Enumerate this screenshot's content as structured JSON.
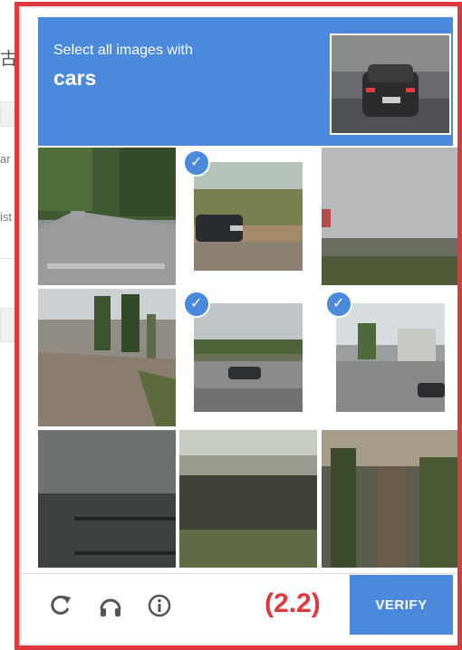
{
  "background": {
    "fragments": [
      "古",
      "ar",
      "ist"
    ]
  },
  "challenge": {
    "instruction": "Select all images with",
    "target": "cars",
    "accent_color": "#4a89dc",
    "tiles": [
      {
        "name": "tile-1",
        "scene": "tree-lined street with parked car",
        "selected": false
      },
      {
        "name": "tile-2",
        "scene": "dark car parked by field",
        "selected": true
      },
      {
        "name": "tile-3",
        "scene": "cloudy sky over trees",
        "selected": false
      },
      {
        "name": "tile-4",
        "scene": "road with trees and poles",
        "selected": false
      },
      {
        "name": "tile-5",
        "scene": "car on highway",
        "selected": true
      },
      {
        "name": "tile-6",
        "scene": "intersection with car and building",
        "selected": true
      },
      {
        "name": "tile-7",
        "scene": "dark railing and building",
        "selected": false
      },
      {
        "name": "tile-8",
        "scene": "bridge underpass",
        "selected": false
      },
      {
        "name": "tile-9",
        "scene": "trees and palm",
        "selected": false
      }
    ],
    "checkmark": "✓"
  },
  "footer": {
    "reload_icon": "reload-icon",
    "audio_icon": "headphones-icon",
    "info_icon": "info-icon",
    "label": "(2.2)",
    "verify_label": "VERIFY"
  }
}
